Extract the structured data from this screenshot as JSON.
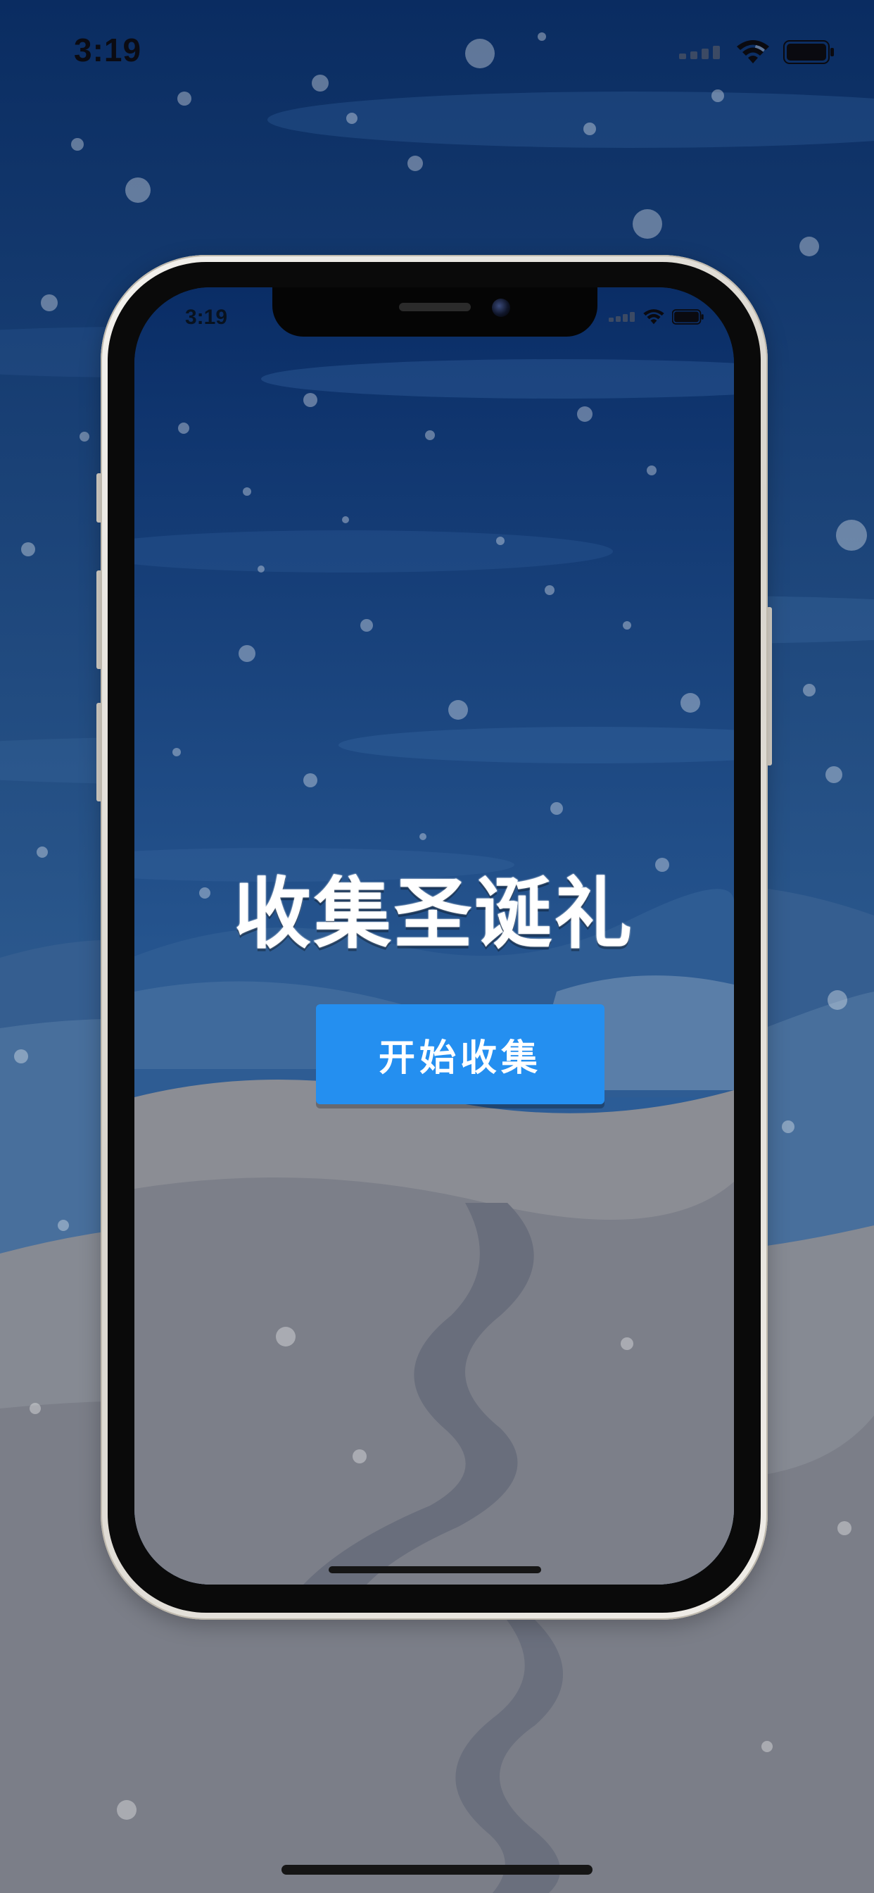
{
  "status_bar": {
    "time": "3:19"
  },
  "phone_preview": {
    "status_bar": {
      "time": "3:19"
    },
    "title": "收集圣诞礼",
    "start_button_label": "开始收集"
  },
  "colors": {
    "sky_top": "#0b2d62",
    "sky_bottom": "#2d5b90",
    "snow_ground": "#8a8a8f",
    "button": "#248ff0",
    "title_text": "#ffffff"
  },
  "icons": [
    "wifi-icon",
    "battery-icon",
    "signal-icon"
  ]
}
